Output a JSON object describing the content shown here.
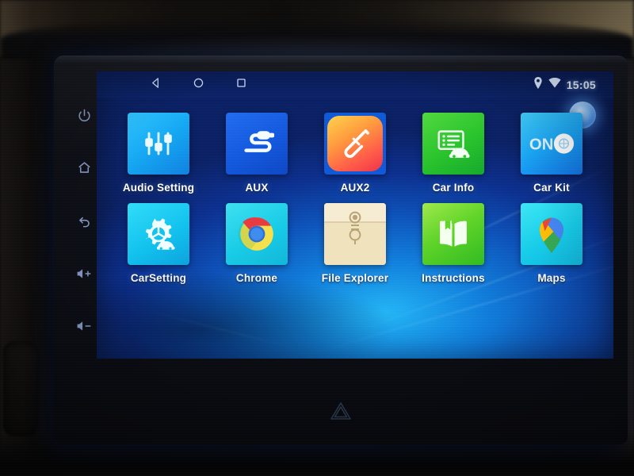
{
  "device": {
    "type": "android-car-head-unit",
    "hazard_icon": "hazard-triangle-icon",
    "side_keys": [
      {
        "name": "power",
        "icon": "power-icon"
      },
      {
        "name": "home",
        "icon": "home-icon"
      },
      {
        "name": "back",
        "icon": "back-arrow-icon"
      },
      {
        "name": "volume-up",
        "icon": "volume-up-icon"
      },
      {
        "name": "volume-down",
        "icon": "volume-down-icon"
      }
    ]
  },
  "status_bar": {
    "nav": [
      {
        "name": "back",
        "icon": "back-triangle-icon"
      },
      {
        "name": "home",
        "icon": "home-circle-icon"
      },
      {
        "name": "recents",
        "icon": "recents-square-icon"
      }
    ],
    "icons": [
      {
        "name": "location",
        "icon": "location-pin-icon"
      },
      {
        "name": "wifi",
        "icon": "wifi-icon"
      }
    ],
    "clock": "15:05"
  },
  "indicator": {
    "name": "status-orb",
    "color": "#7fb9f5"
  },
  "home": {
    "apps": [
      {
        "label": "Audio Setting",
        "icon": "audio-sliders-icon",
        "bg": "#12a7f2"
      },
      {
        "label": "AUX",
        "icon": "aux-cable-icon",
        "bg": "#1157dd"
      },
      {
        "label": "AUX2",
        "icon": "aux2-plug-icon",
        "bg": "#ff5a47"
      },
      {
        "label": "Car Info",
        "icon": "car-info-list-icon",
        "bg": "#27c32a"
      },
      {
        "label": "Car Kit",
        "icon": "toggle-on-icon",
        "bg": "#17a4f5"
      },
      {
        "label": "CarSetting",
        "icon": "gear-car-icon",
        "bg": "#10c2ee"
      },
      {
        "label": "Chrome",
        "icon": "chrome-icon",
        "bg": "#16cbe6"
      },
      {
        "label": "File Explorer",
        "icon": "folder-envelope-icon",
        "bg": "#f0e0b6"
      },
      {
        "label": "Instructions",
        "icon": "open-book-icon",
        "bg": "#5fd427"
      },
      {
        "label": "Maps",
        "icon": "map-pin-icon",
        "bg": "#14cbe8"
      }
    ]
  }
}
